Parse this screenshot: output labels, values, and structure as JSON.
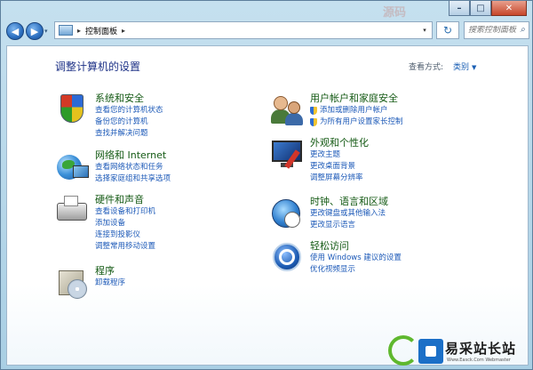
{
  "window": {
    "minimize": "–",
    "maximize": "□",
    "close": "✕",
    "background_deco": "源码"
  },
  "nav": {
    "back": "◀",
    "forward": "▶",
    "history": "▾",
    "address_chevron": "▸",
    "address_text": "控制面板",
    "address_chevron2": "▸",
    "address_dropdown": "▾",
    "refresh": "↻",
    "search_placeholder": "搜索控制面板",
    "search_icon": "⌕"
  },
  "main": {
    "title": "调整计算机的设置",
    "view_by_label": "查看方式:",
    "view_by_value": "类别",
    "view_by_caret": "▼"
  },
  "categories_left": [
    {
      "icon": "shield-icon",
      "title": "系统和安全",
      "links": [
        "查看您的计算机状态",
        "备份您的计算机",
        "查找并解决问题"
      ]
    },
    {
      "icon": "network-globe-icon",
      "title": "网络和 Internet",
      "links": [
        "查看网络状态和任务",
        "选择家庭组和共享选项"
      ]
    },
    {
      "icon": "printer-icon",
      "title": "硬件和声音",
      "links": [
        "查看设备和打印机",
        "添加设备",
        "连接到投影仪",
        "调整常用移动设置"
      ]
    },
    {
      "icon": "programs-icon",
      "title": "程序",
      "links": [
        "卸载程序"
      ]
    }
  ],
  "categories_right": [
    {
      "icon": "users-icon",
      "title": "用户帐户和家庭安全",
      "links": [
        "添加或删除用户帐户",
        "为所有用户设置家长控制"
      ],
      "shielded": true
    },
    {
      "icon": "display-icon",
      "title": "外观和个性化",
      "links": [
        "更改主题",
        "更改桌面背景",
        "调整屏幕分辨率"
      ]
    },
    {
      "icon": "clock-globe-icon",
      "title": "时钟、语言和区域",
      "links": [
        "更改键盘或其他输入法",
        "更改显示语言"
      ]
    },
    {
      "icon": "accessibility-icon",
      "title": "轻松访问",
      "links": [
        "使用 Windows 建议的设置",
        "优化视频显示"
      ]
    }
  ],
  "watermark": {
    "text": "易采站长站",
    "url": "Www.Easck.Com Webmaster"
  }
}
